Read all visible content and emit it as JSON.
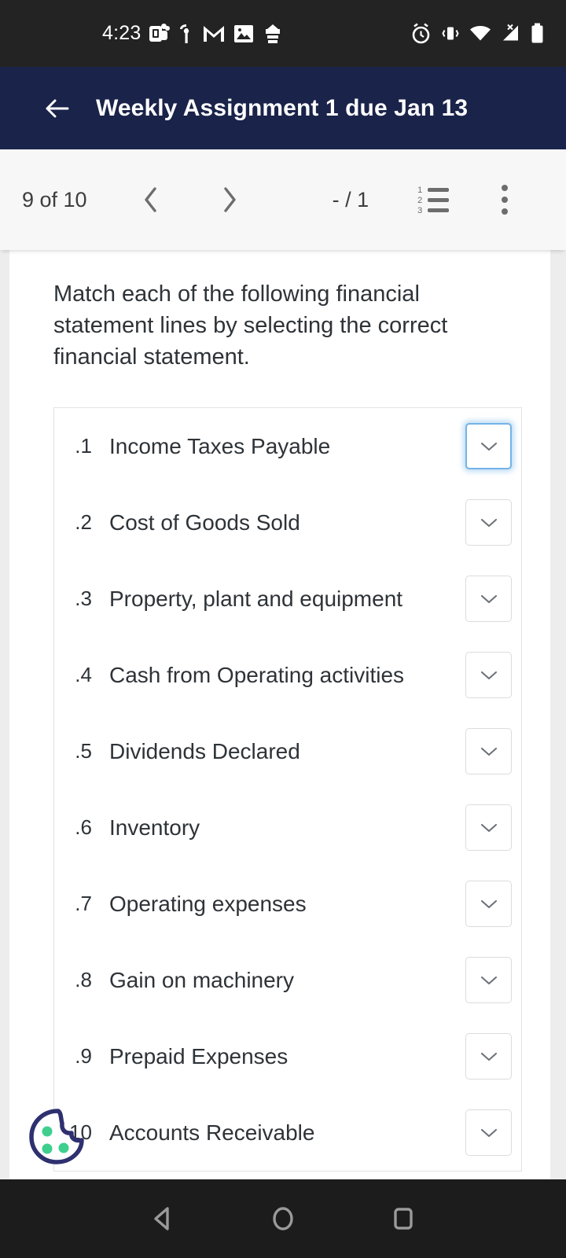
{
  "status_bar": {
    "time": "4:23",
    "left_icons": [
      "teams-icon",
      "pin-info-icon",
      "gmail-icon",
      "photos-icon",
      "app-icon"
    ],
    "right_icons": [
      "alarm-icon",
      "vibrate-icon",
      "wifi-icon",
      "cellular-no-sim-icon",
      "battery-icon"
    ],
    "background": "#232323"
  },
  "app_bar": {
    "back_label": "Back",
    "title": "Weekly Assignment 1 due Jan 13",
    "background": "#1a2349",
    "text_color": "#ffffff"
  },
  "toolbar": {
    "progress": "9 of 10",
    "prev_label": "Previous question",
    "next_label": "Next question",
    "score": "- / 1",
    "question_list_label": "Question list",
    "more_label": "More options",
    "background": "#f7f7f7"
  },
  "question": {
    "prompt": "Match each of the following financial statement lines by selecting the correct financial statement.",
    "items": [
      {
        "number": "1.",
        "label": "Income Taxes Payable",
        "value": "",
        "focused": true
      },
      {
        "number": "2.",
        "label": "Cost of Goods Sold",
        "value": "",
        "focused": false
      },
      {
        "number": "3.",
        "label": "Property, plant and equipment",
        "value": "",
        "focused": false
      },
      {
        "number": "4.",
        "label": "Cash from Operating activities",
        "value": "",
        "focused": false
      },
      {
        "number": "5.",
        "label": "Dividends Declared",
        "value": "",
        "focused": false
      },
      {
        "number": "6.",
        "label": "Inventory",
        "value": "",
        "focused": false
      },
      {
        "number": "7.",
        "label": "Operating expenses",
        "value": "",
        "focused": false
      },
      {
        "number": "8.",
        "label": "Gain on machinery",
        "value": "",
        "focused": false
      },
      {
        "number": "9.",
        "label": "Prepaid Expenses",
        "value": "",
        "focused": false
      },
      {
        "number": "10.",
        "label": "Accounts Receivable",
        "value": "",
        "focused": false
      }
    ],
    "dropdown_placeholder": "",
    "focus_color": "#74b3e8",
    "text_color": "#2e3338"
  },
  "cookie_widget": {
    "name": "cookie-consent-icon",
    "outline_color": "#2e3070",
    "chip_color": "#3ecf8e"
  },
  "nav_bar": {
    "back": "back-triangle-icon",
    "home": "home-circle-icon",
    "recents": "recents-square-icon",
    "background": "#1c1c1c"
  }
}
